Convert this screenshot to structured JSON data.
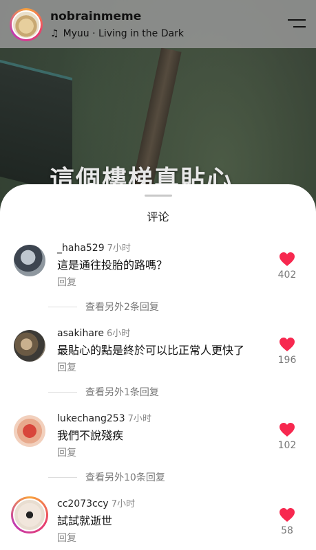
{
  "header": {
    "username": "nobrainmeme",
    "music_icon": "music-note-icon",
    "music_text": "Myuu · Living in the Dark",
    "menu_icon": "menu-icon"
  },
  "video": {
    "caption": "這個樓梯真貼心"
  },
  "sheet": {
    "title": "评论"
  },
  "colors": {
    "like_red": "#f7284f",
    "header_bg": "#969696"
  },
  "comments": [
    {
      "username": "_haha529",
      "time": "7小时",
      "text": "這是通往投胎的路嗎？",
      "reply_label": "回复",
      "likes": "402",
      "more_replies": "查看另外2条回复"
    },
    {
      "username": "asakihare",
      "time": "6小时",
      "text": "最貼心的點是終於可以比正常人更快了",
      "reply_label": "回复",
      "likes": "196",
      "more_replies": "查看另外1条回复"
    },
    {
      "username": "lukechang253",
      "time": "7小时",
      "text": "我們不說殘疾",
      "reply_label": "回复",
      "likes": "102",
      "more_replies": "查看另外10条回复"
    },
    {
      "username": "cc2073ccy",
      "time": "7小时",
      "text": "試試就逝世",
      "reply_label": "回复",
      "likes": "58"
    }
  ]
}
